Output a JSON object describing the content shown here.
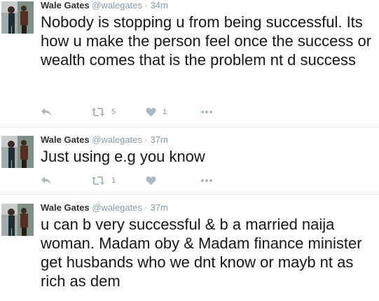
{
  "tweets": [
    {
      "name": "Wale Gates",
      "handle": "@walegates",
      "separator": "·",
      "time": "34m",
      "text": "Nobody is stopping u from being successful. Its how u make the person feel once the success or wealth comes that is the problem nt d success",
      "retweets": "5",
      "likes": "1"
    },
    {
      "name": "Wale Gates",
      "handle": "@walegates",
      "separator": "·",
      "time": "37m",
      "text": "Just using e.g you know",
      "retweets": "1",
      "likes": ""
    },
    {
      "name": "Wale Gates",
      "handle": "@walegates",
      "separator": "·",
      "time": "37m",
      "text": "u can b very successful & b a married naija woman. Madam oby & Madam finance minister get husbands who we dnt know or mayb nt as rich as dem",
      "retweets": "",
      "likes": ""
    }
  ],
  "icons": {
    "reply": "reply-icon",
    "retweet": "retweet-icon",
    "like": "heart-icon",
    "more": "more-icon"
  },
  "colors": {
    "icon": "#aab8c2",
    "muted_text": "#8899a6",
    "divider": "#e1e8ed",
    "tweet_text": "#14171a"
  }
}
